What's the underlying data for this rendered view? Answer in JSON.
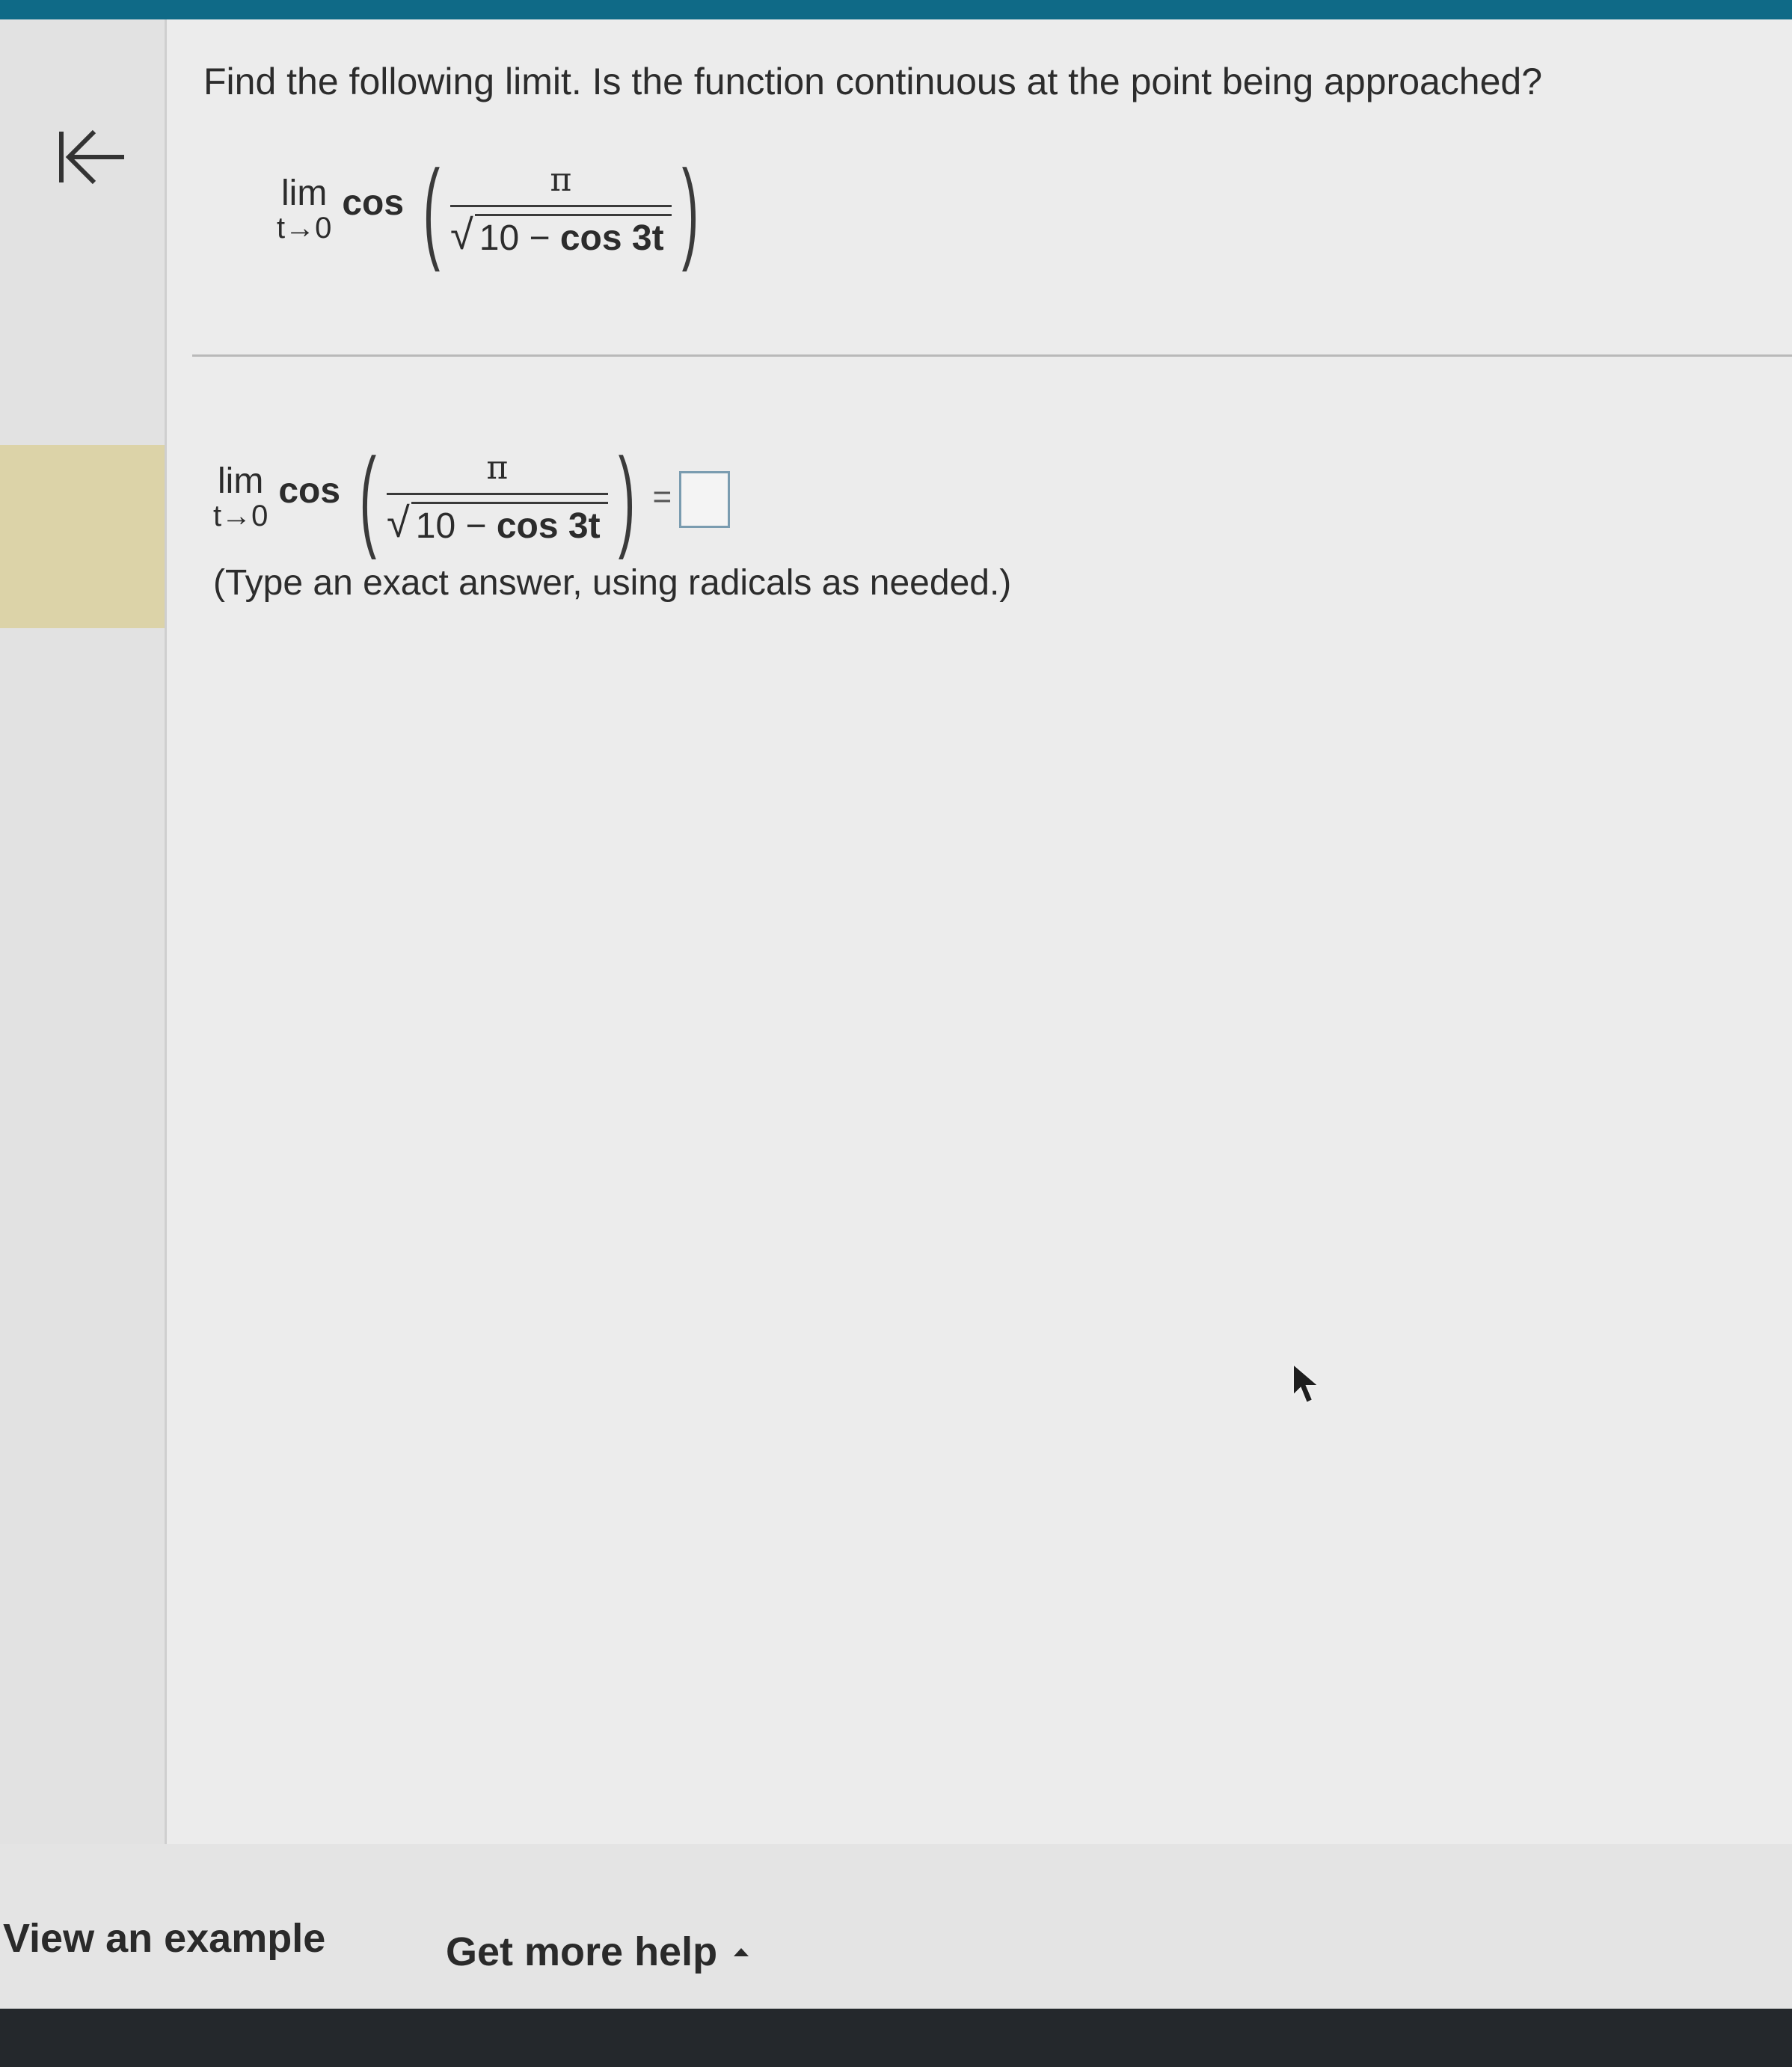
{
  "question": {
    "text": "Find the following limit. Is the function continuous at the point being approached?"
  },
  "expression": {
    "lim": "lim",
    "subscript": "t→0",
    "function": "cos",
    "numerator": "π",
    "radicand_const": "10",
    "radicand_minus": " − ",
    "radicand_trig": "cos 3t",
    "equals": "="
  },
  "answer": {
    "value": "",
    "hint": "(Type an exact answer, using radicals as needed.)"
  },
  "footer": {
    "view_example": "View an example",
    "get_more_help": "Get more help"
  },
  "colors": {
    "top_bar": "#0f6a87",
    "sidebar_highlight": "#dcd3a8",
    "answer_box_border": "#7a9cb0"
  },
  "icons": {
    "collapse": "collapse-left-arrow-icon",
    "help_caret": "caret-up-icon",
    "pointer": "mouse-pointer-icon"
  }
}
